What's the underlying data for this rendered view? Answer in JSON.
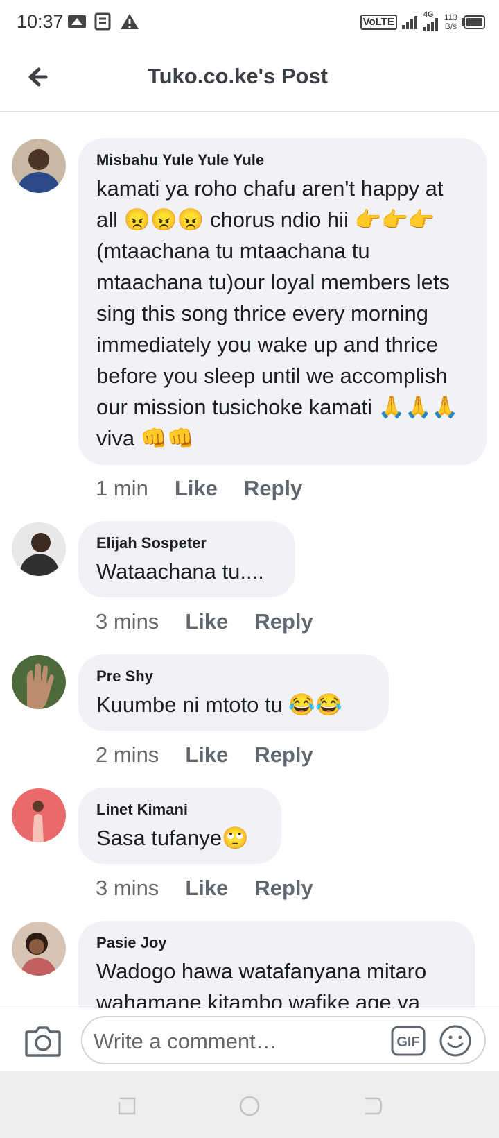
{
  "status_bar": {
    "time": "10:37",
    "network": "VoLTE",
    "signal_label": "4G",
    "speed_value": "113",
    "speed_unit": "B/s"
  },
  "header": {
    "title": "Tuko.co.ke's Post"
  },
  "comments": [
    {
      "author": "Misbahu Yule Yule Yule",
      "text": "kamati ya roho chafu aren't happy at all 😠😠😠   chorus ndio hii 👉👉👉(mtaachana tu mtaachana tu mtaachana tu)our loyal members lets sing this song thrice every morning immediately you wake up and thrice before you sleep until we accomplish our mission tusichoke kamati  🙏🙏🙏 viva 👊👊",
      "time": "1 min",
      "like": "Like",
      "reply": "Reply"
    },
    {
      "author": "Elijah Sospeter",
      "text": "Wataachana tu....",
      "time": "3 mins",
      "like": "Like",
      "reply": "Reply"
    },
    {
      "author": "Pre Shy",
      "text": "Kuumbe ni mtoto tu 😂😂",
      "time": "2 mins",
      "like": "Like",
      "reply": "Reply"
    },
    {
      "author": "Linet Kimani",
      "text": "Sasa tufanye🙄",
      "time": "3 mins",
      "like": "Like",
      "reply": "Reply"
    },
    {
      "author": "Pasie Joy",
      "text": "Wadogo hawa watafanyana mitaro wahamane kitambo wafike age ya"
    }
  ],
  "composer": {
    "placeholder": "Write a comment…",
    "gif_label": "GIF"
  },
  "colors": {
    "bubble": "#f0f2f5",
    "secondary_text": "#65676b",
    "divider": "#dadde1"
  }
}
